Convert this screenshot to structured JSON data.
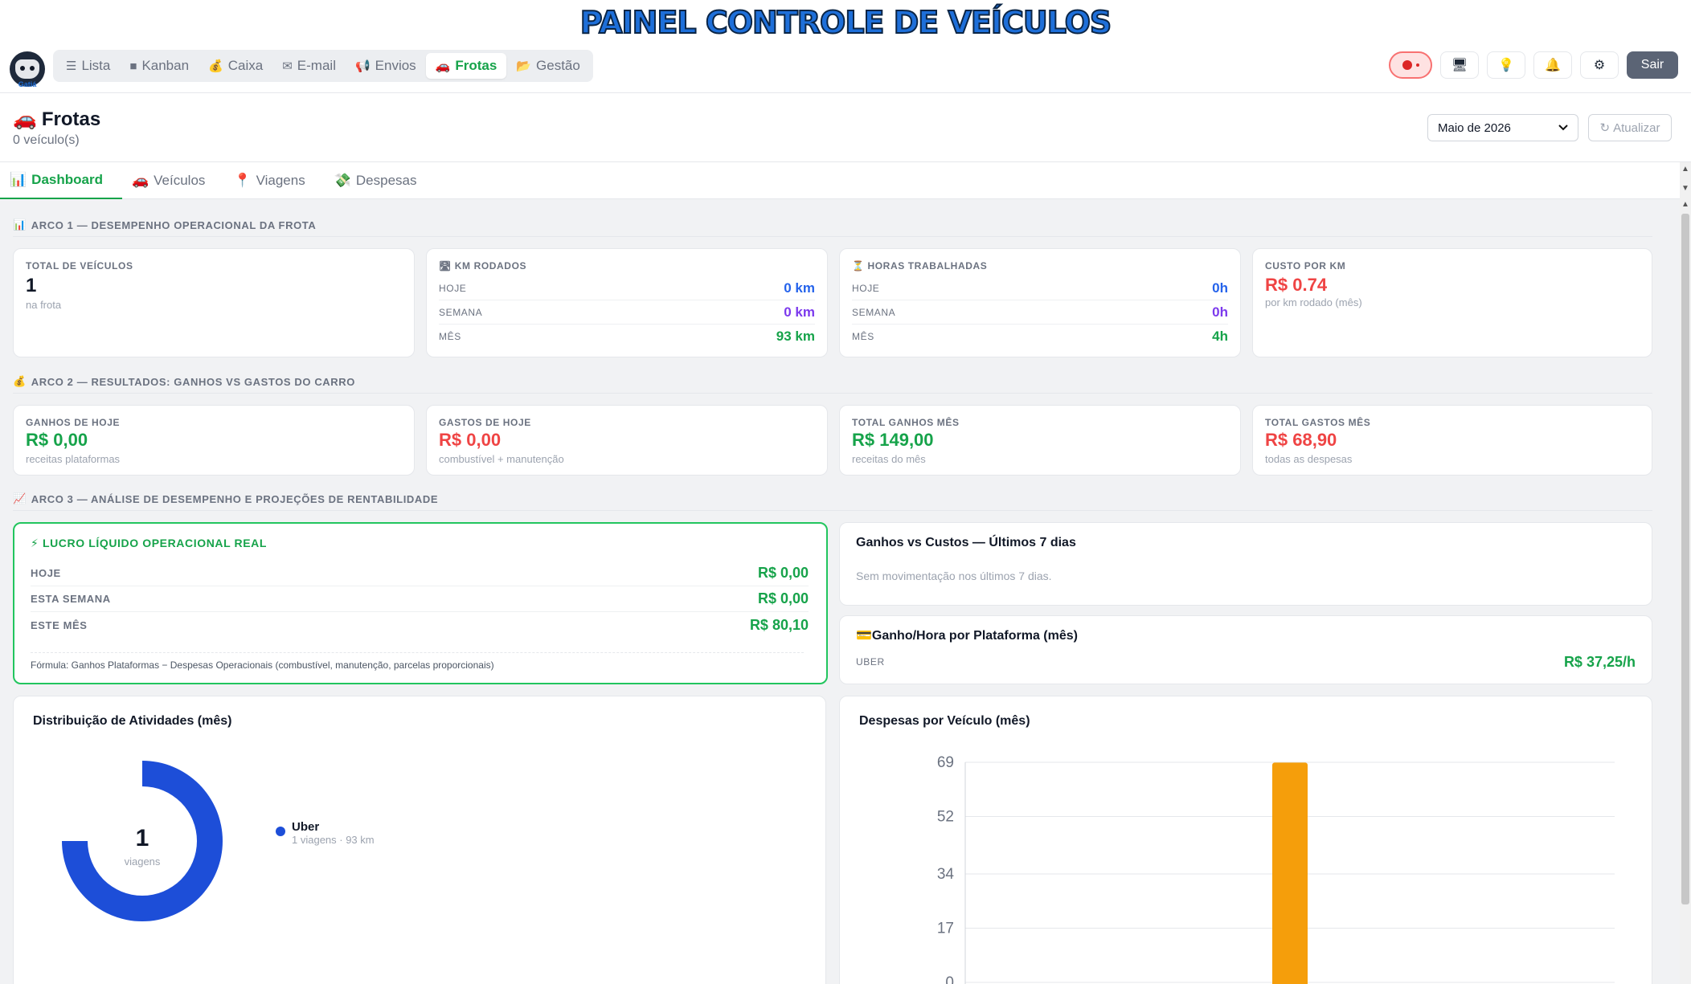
{
  "banner": {
    "title": "PAINEL CONTROLE DE VEÍCULOS"
  },
  "logo": {
    "text": "Gatiá"
  },
  "nav": {
    "items": [
      {
        "icon": "☰",
        "label": "Lista"
      },
      {
        "icon": "■",
        "label": "Kanban"
      },
      {
        "icon": "💰",
        "label": "Caixa"
      },
      {
        "icon": "✉",
        "label": "E-mail"
      },
      {
        "icon": "📢",
        "label": "Envios"
      },
      {
        "icon": "🚗",
        "label": "Frotas"
      },
      {
        "icon": "📂",
        "label": "Gestão"
      }
    ]
  },
  "actions": {
    "logout": "Sair",
    "monitor_icon": "🖥",
    "bulb_icon": "💡",
    "bell_icon": "🔔",
    "gear_icon": "⚙"
  },
  "header": {
    "title": "Frotas",
    "title_icon": "🚗",
    "subtitle": "0 veículo(s)",
    "month": "Maio de 2026",
    "refresh": "Atualizar",
    "refresh_icon": "↻"
  },
  "tabs": [
    {
      "icon": "📊",
      "label": "Dashboard"
    },
    {
      "icon": "🚗",
      "label": "Veículos"
    },
    {
      "icon": "📍",
      "label": "Viagens"
    },
    {
      "icon": "💸",
      "label": "Despesas"
    }
  ],
  "arco1": {
    "title": "ARCO 1 — DESEMPENHO OPERACIONAL DA FROTA",
    "icon": "📊",
    "total": {
      "label": "TOTAL DE VEÍCULOS",
      "value": "1",
      "sub": "na frota"
    },
    "km": {
      "label": "KM RODADOS",
      "icon": "🛣",
      "rows": [
        {
          "label": "HOJE",
          "value": "0 km"
        },
        {
          "label": "SEMANA",
          "value": "0 km"
        },
        {
          "label": "MÊS",
          "value": "93 km"
        }
      ]
    },
    "horas": {
      "label": "HORAS TRABALHADAS",
      "icon": "⏳",
      "rows": [
        {
          "label": "HOJE",
          "value": "0h"
        },
        {
          "label": "SEMANA",
          "value": "0h"
        },
        {
          "label": "MÊS",
          "value": "4h"
        }
      ]
    },
    "custo": {
      "label": "CUSTO POR KM",
      "value": "R$ 0.74",
      "sub": "por km rodado (mês)"
    }
  },
  "arco2": {
    "title": "ARCO 2 — RESULTADOS: GANHOS VS GASTOS DO CARRO",
    "icon": "💰",
    "cards": [
      {
        "label": "GANHOS DE HOJE",
        "value": "R$ 0,00",
        "sub": "receitas plataformas"
      },
      {
        "label": "GASTOS DE HOJE",
        "value": "R$ 0,00",
        "sub": "combustível + manutenção"
      },
      {
        "label": "TOTAL GANHOS MÊS",
        "value": "R$ 149,00",
        "sub": "receitas do mês"
      },
      {
        "label": "TOTAL GASTOS MÊS",
        "value": "R$ 68,90",
        "sub": "todas as despesas"
      }
    ]
  },
  "arco3": {
    "title": "ARCO 3 — ANÁLISE DE DESEMPENHO E PROJEÇÕES DE RENTABILIDADE",
    "icon": "📈",
    "lucro": {
      "title": "LUCRO LÍQUIDO OPERACIONAL REAL",
      "icon": "⚡",
      "rows": [
        {
          "label": "HOJE",
          "value": "R$ 0,00"
        },
        {
          "label": "ESTA SEMANA",
          "value": "R$ 0,00"
        },
        {
          "label": "ESTE MÊS",
          "value": "R$ 80,10"
        }
      ],
      "formula": "Fórmula: Ganhos Plataformas − Despesas Operacionais (combustível, manutenção, parcelas proporcionais)"
    },
    "ganhos_custos": {
      "title": "Ganhos vs Custos — Últimos 7 dias",
      "empty": "Sem movimentação nos últimos 7 dias."
    },
    "ganho_hora": {
      "title": "Ganho/Hora por Plataforma (mês)",
      "icon": "💳",
      "platform": "UBER",
      "value": "R$ 37,25/h"
    }
  },
  "distribuicao": {
    "title": "Distribuição de Atividades (mês)",
    "center_value": "1",
    "center_label": "viagens",
    "legend": [
      {
        "name": "Uber",
        "detail": "1 viagens · 93 km",
        "color": "#1d4ed8"
      }
    ]
  },
  "chart_data": {
    "type": "bar",
    "title": "Despesas por Veículo (mês)",
    "categories": [
      ""
    ],
    "values": [
      68.9
    ],
    "yticks": [
      "69",
      "52",
      "34",
      "17",
      "0"
    ],
    "ylim": [
      0,
      69
    ],
    "color": "#f59e0b",
    "grid": true
  }
}
